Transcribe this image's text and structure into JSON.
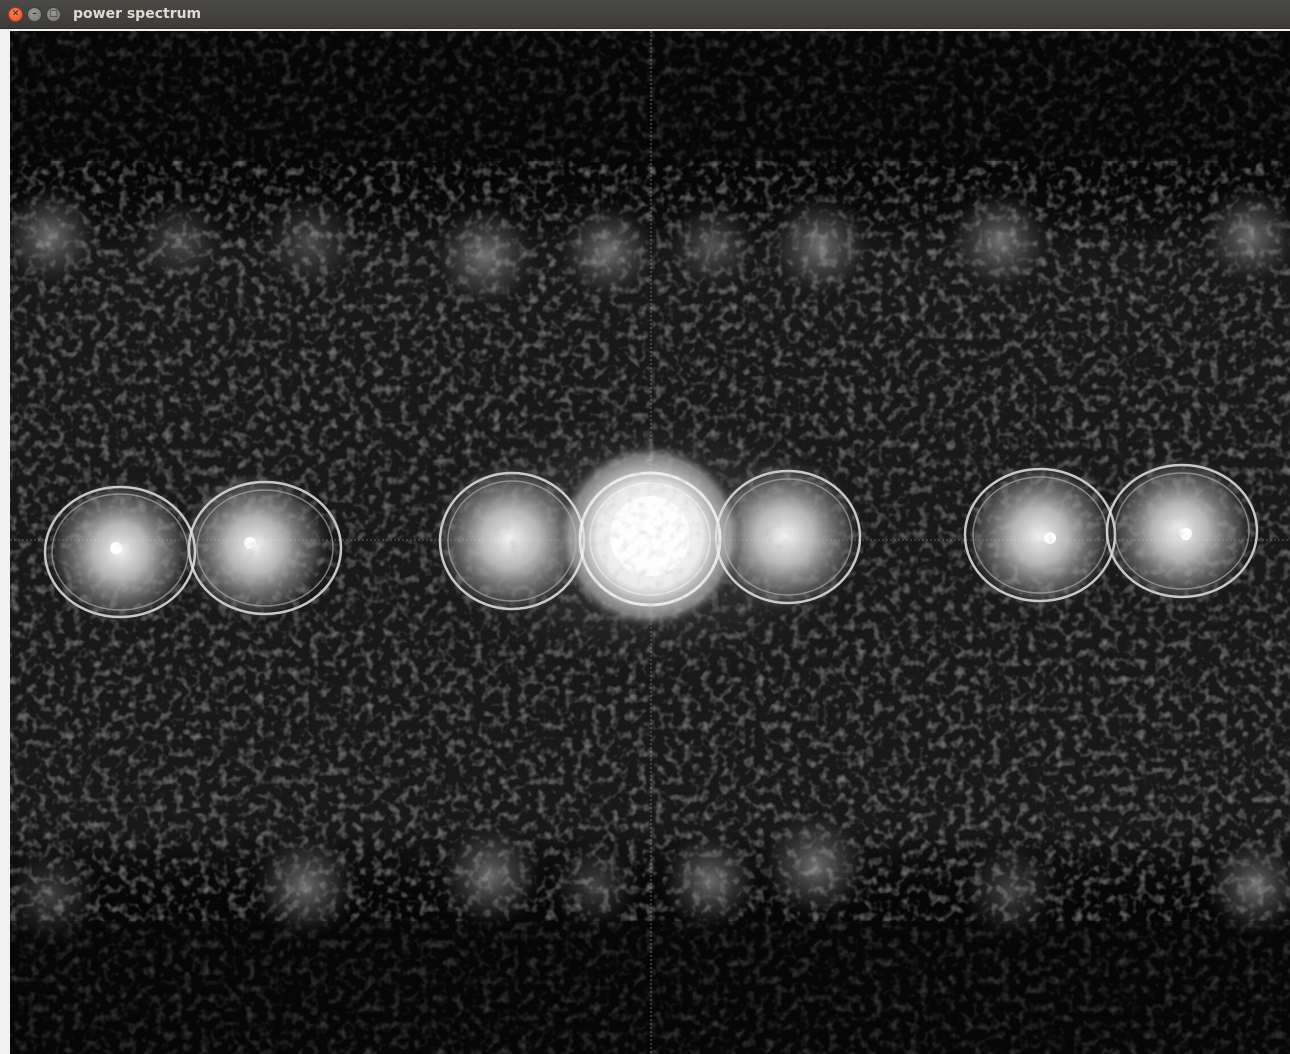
{
  "window": {
    "title": "power spectrum",
    "controls": {
      "close_icon": "close-icon",
      "minimize_icon": "minimize-icon",
      "maximize_icon": "maximize-icon"
    }
  },
  "canvas": {
    "content": "power-spectrum-image",
    "background_color": "#050505",
    "glow_color": "#ffffff"
  }
}
